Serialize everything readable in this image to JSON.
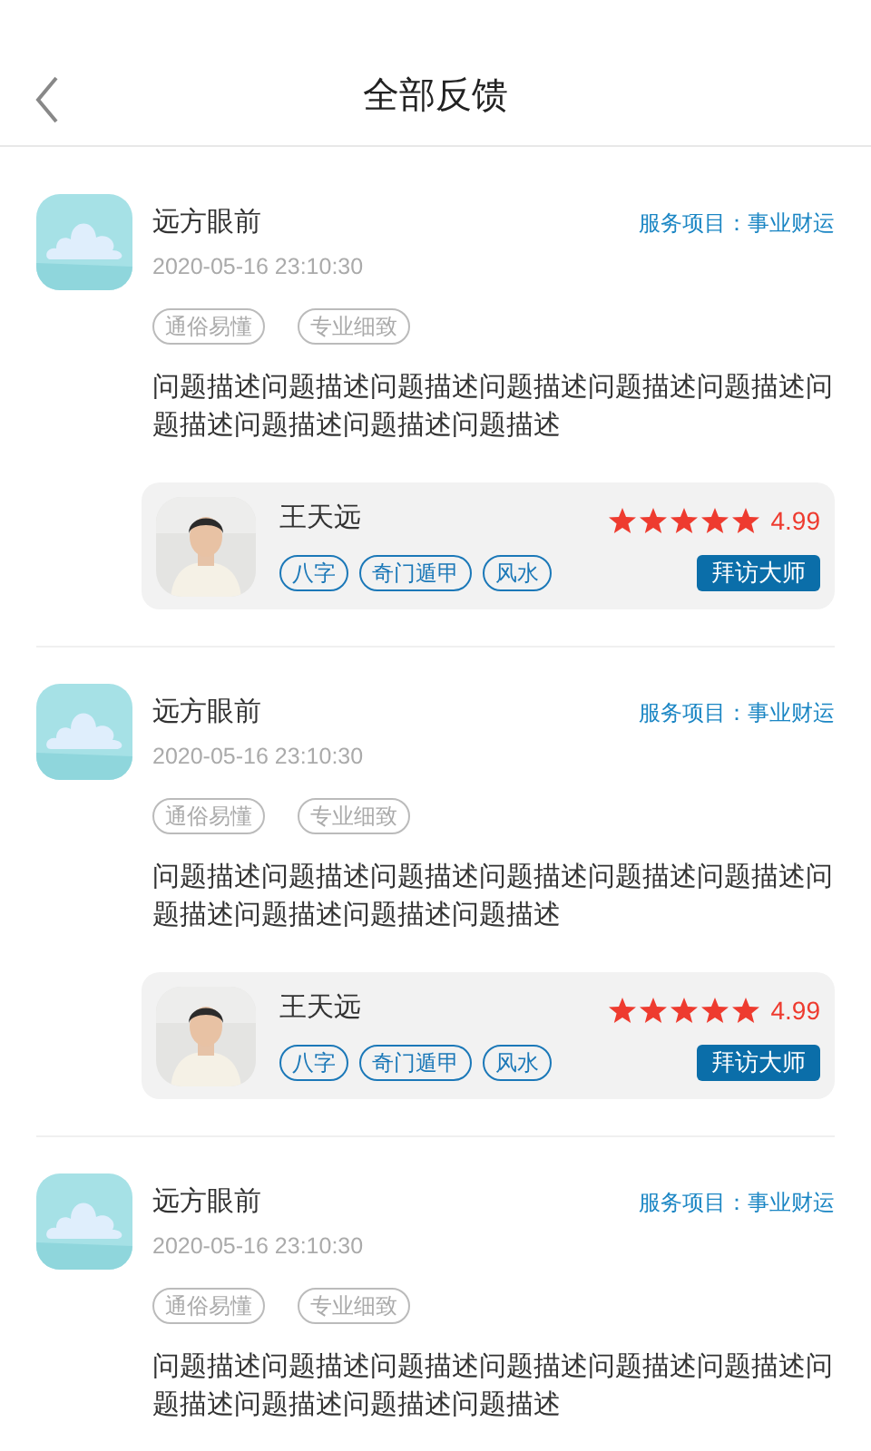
{
  "header": {
    "title": "全部反馈"
  },
  "feedback": [
    {
      "user": "远方眼前",
      "service": "服务项目：事业财运",
      "time": "2020-05-16 23:10:30",
      "tags": [
        "通俗易懂",
        "专业细致"
      ],
      "text": "问题描述问题描述问题描述问题描述问题描述问题描述问题描述问题描述问题描述问题描述",
      "master": {
        "name": "王天远",
        "stars": 5,
        "rating": "4.99",
        "tags": [
          "八字",
          "奇门遁甲",
          "风水"
        ],
        "button": "拜访大师"
      }
    },
    {
      "user": "远方眼前",
      "service": "服务项目：事业财运",
      "time": "2020-05-16 23:10:30",
      "tags": [
        "通俗易懂",
        "专业细致"
      ],
      "text": "问题描述问题描述问题描述问题描述问题描述问题描述问题描述问题描述问题描述问题描述",
      "master": {
        "name": "王天远",
        "stars": 5,
        "rating": "4.99",
        "tags": [
          "八字",
          "奇门遁甲",
          "风水"
        ],
        "button": "拜访大师"
      }
    },
    {
      "user": "远方眼前",
      "service": "服务项目：事业财运",
      "time": "2020-05-16 23:10:30",
      "tags": [
        "通俗易懂",
        "专业细致"
      ],
      "text": "问题描述问题描述问题描述问题描述问题描述问题描述问题描述问题描述问题描述问题描述"
    }
  ]
}
